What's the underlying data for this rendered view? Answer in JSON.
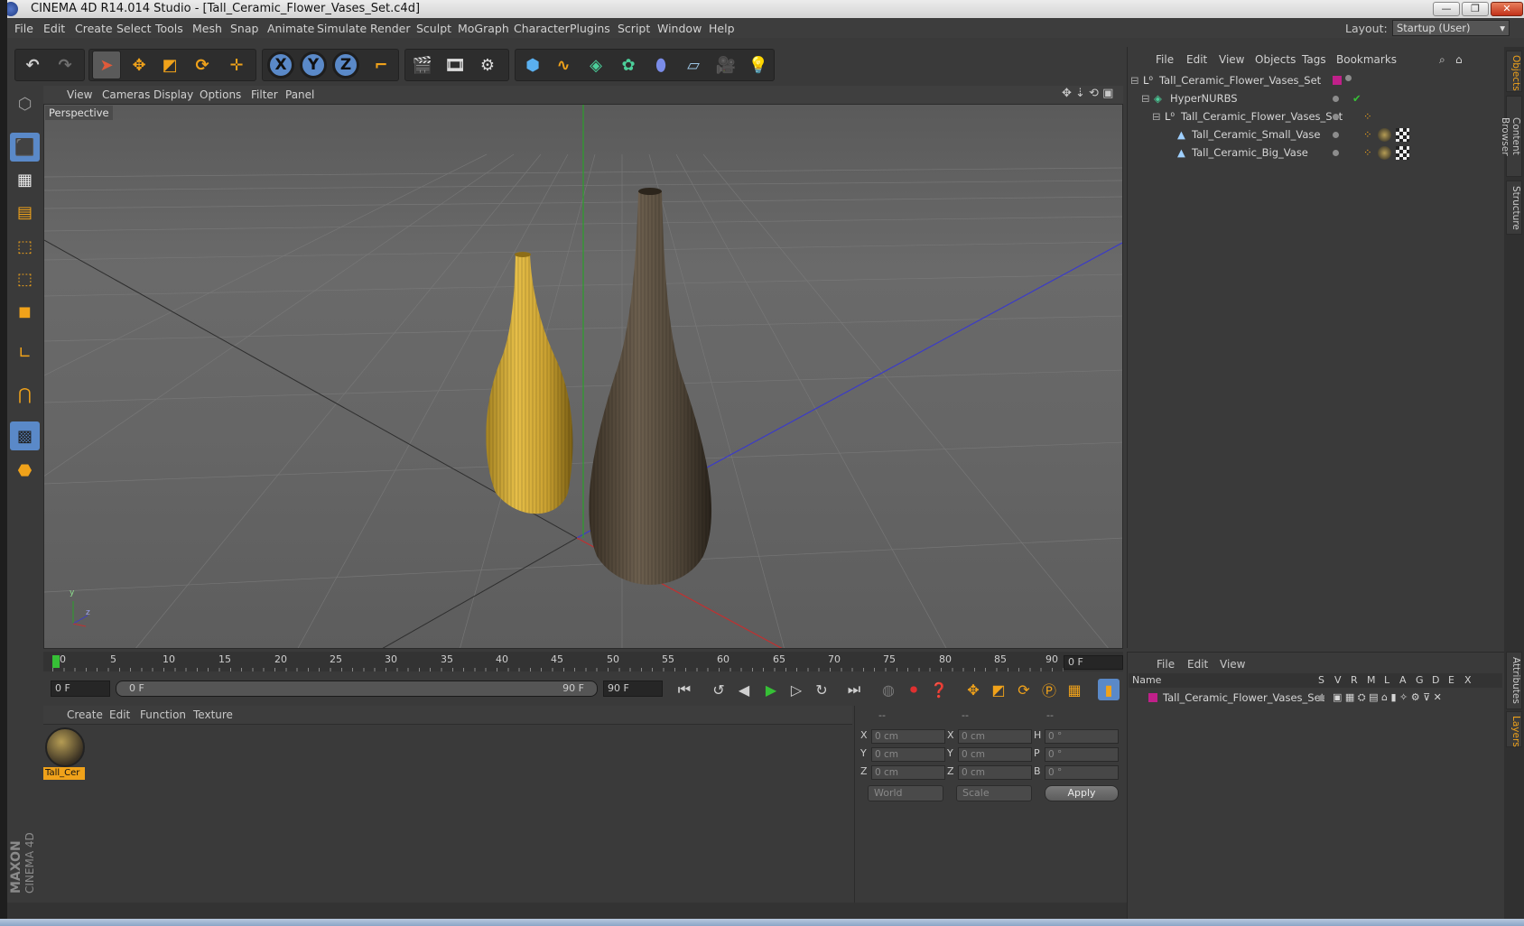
{
  "window": {
    "title": "CINEMA 4D R14.014 Studio - [Tall_Ceramic_Flower_Vases_Set.c4d]",
    "minimize": "—",
    "restore": "❐",
    "close": "✕"
  },
  "menubar": {
    "items": [
      "File",
      "Edit",
      "Create",
      "Select",
      "Tools",
      "Mesh",
      "Snap",
      "Animate",
      "Simulate",
      "Render",
      "Sculpt",
      "MoGraph",
      "Character",
      "Plugins",
      "Script",
      "Window",
      "Help"
    ],
    "layout_label": "Layout:",
    "layout_value": "Startup (User)"
  },
  "viewport": {
    "menus": [
      "View",
      "Cameras",
      "Display",
      "Options",
      "Filter",
      "Panel"
    ],
    "label": "Perspective",
    "axis_x": "z",
    "axis_y": "y"
  },
  "timeline": {
    "ticks": [
      "0",
      "5",
      "10",
      "15",
      "20",
      "25",
      "30",
      "35",
      "40",
      "45",
      "50",
      "55",
      "60",
      "65",
      "70",
      "75",
      "80",
      "85",
      "90"
    ],
    "current_frame": "0 F",
    "start_field": "0 F",
    "range_start": "0 F",
    "range_end": "90 F",
    "end_field": "90 F"
  },
  "material_manager": {
    "menus": [
      "Create",
      "Edit",
      "Function",
      "Texture"
    ],
    "material_name": "Tall_Cer"
  },
  "coordinates": {
    "headers": [
      "--",
      "--",
      "--"
    ],
    "rows": [
      {
        "pos_label": "X",
        "pos": "0 cm",
        "size_label": "X",
        "size": "0 cm",
        "rot_label": "H",
        "rot": "0 °"
      },
      {
        "pos_label": "Y",
        "pos": "0 cm",
        "size_label": "Y",
        "size": "0 cm",
        "rot_label": "P",
        "rot": "0 °"
      },
      {
        "pos_label": "Z",
        "pos": "0 cm",
        "size_label": "Z",
        "size": "0 cm",
        "rot_label": "B",
        "rot": "0 °"
      }
    ],
    "mode": "World",
    "size_mode": "Scale",
    "apply": "Apply"
  },
  "object_manager": {
    "menus": [
      "File",
      "Edit",
      "View",
      "Objects",
      "Tags",
      "Bookmarks"
    ],
    "objects": [
      {
        "name": "Tall_Ceramic_Flower_Vases_Set",
        "depth": 0
      },
      {
        "name": "HyperNURBS",
        "depth": 1
      },
      {
        "name": "Tall_Ceramic_Flower_Vases_Set",
        "depth": 2
      },
      {
        "name": "Tall_Ceramic_Small_Vase",
        "depth": 3
      },
      {
        "name": "Tall_Ceramic_Big_Vase",
        "depth": 3
      }
    ],
    "tag_color": "#c0208a"
  },
  "layer_manager": {
    "menus": [
      "File",
      "Edit",
      "View"
    ],
    "columns": [
      "Name",
      "S",
      "V",
      "R",
      "M",
      "L",
      "A",
      "G",
      "D",
      "E",
      "X"
    ],
    "layers": [
      {
        "name": "Tall_Ceramic_Flower_Vases_Set",
        "color": "#c0208a"
      }
    ]
  },
  "right_tabs": [
    "Objects",
    "Content Browser",
    "Structure",
    "Attributes",
    "Layers"
  ],
  "branding": {
    "line1": "MAXON",
    "line2": "CINEMA 4D"
  },
  "colors": {
    "accent_orange": "#f0a21a",
    "axis_blue": "#5a89c8",
    "play_green": "#36c036"
  }
}
